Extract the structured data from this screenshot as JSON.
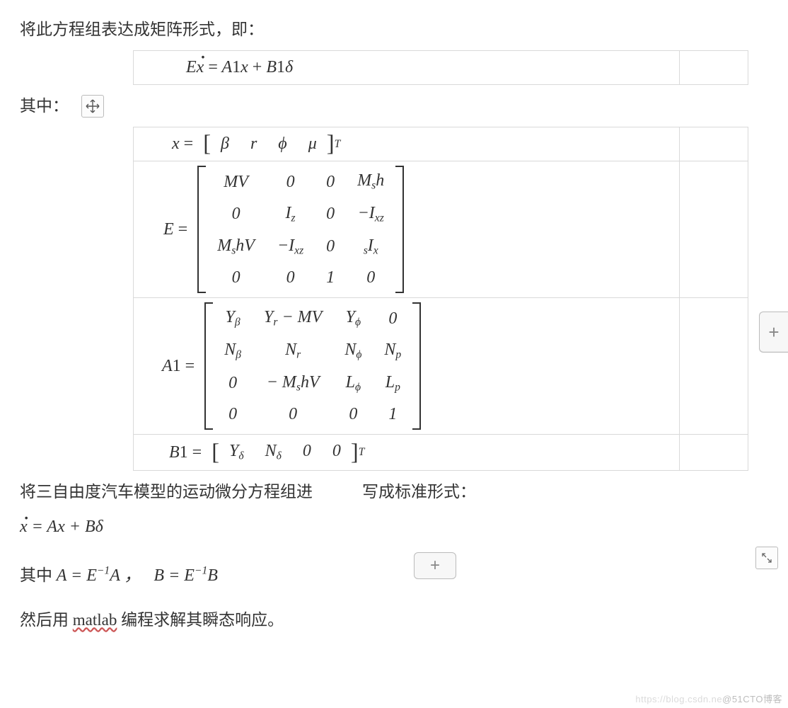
{
  "line1": "将此方程组表达成矩阵形式，即：",
  "eq1_html": "E<span class='over-dot'>x</span> <span class='rm'>=</span> A<span class='rm'>1</span>x <span class='rm'>+</span> B<span class='rm'>1</span>δ",
  "line2": "其中：",
  "x_lhs": "x <span class='rm'>=</span>",
  "x_vec": [
    "β",
    "r",
    "ϕ",
    "μ"
  ],
  "x_sup": "T",
  "E_lhs": "E <span class='rm'>=</span>",
  "E_rows": [
    [
      "MV",
      "0",
      "0",
      "M<sub>s</sub>h"
    ],
    [
      "0",
      "I<sub>z</sub>",
      "0",
      "−I<sub>xz</sub>"
    ],
    [
      "M<sub>s</sub>hV",
      "−I<sub>xz</sub>",
      "0",
      "<sub>s</sub>I<sub>x</sub>"
    ],
    [
      "0",
      "0",
      "1",
      "0"
    ]
  ],
  "A1_lhs": "A<span class='rm'>1</span> <span class='rm'>=</span>",
  "A1_rows": [
    [
      "Y<sub>β</sub>",
      "Y<sub>r</sub> − MV",
      "Y<sub>ϕ</sub>",
      "0"
    ],
    [
      "N<sub>β</sub>",
      "N<sub>r</sub>",
      "N<sub>ϕ</sub>",
      "N<sub>p</sub>"
    ],
    [
      "0",
      "− M<sub>s</sub>hV",
      "L<sub>ϕ</sub>",
      "L<sub>p</sub>"
    ],
    [
      "0",
      "0",
      "0",
      "1"
    ]
  ],
  "B1_lhs": "B<span class='rm'>1</span> <span class='rm'>=</span>",
  "B1_vec": [
    "Y<sub>δ</sub>",
    "N<sub>δ</sub>",
    "0",
    "0"
  ],
  "B1_sup": "T",
  "line3_a": "将三自由度汽车模型的运动微分方程组进",
  "line3_b": "写成标准形式：",
  "eq2_html": "<span class='over-dot'>x</span> <span class='rm'>=</span> Ax <span class='rm'>+</span> Bδ",
  "line4_pre": "其中 ",
  "line4_eq": "A <span class='rm'>=</span> E<sup>−1</sup>A <span class='rm'>，</span>&nbsp;&nbsp; B <span class='rm'>=</span> E<sup>−1</sup>B",
  "line5_a": "然后用 ",
  "line5_m": "matlab",
  "line5_b": " 编程求解其瞬态响应。",
  "watermark_a": "https://blog.csdn.ne",
  "watermark_b": "@51CTO博客"
}
